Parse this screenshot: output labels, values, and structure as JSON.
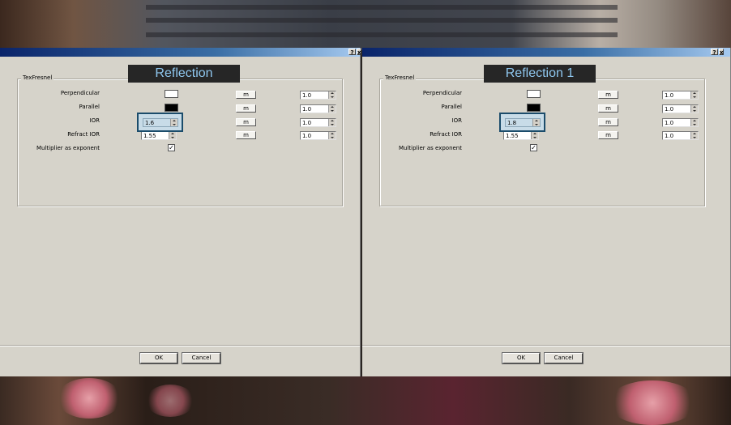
{
  "dialogs": [
    {
      "heading": "Reflection",
      "title_help_icon": "?",
      "title_close_icon": "x",
      "group_label": "TexFresnel",
      "rows": {
        "perpendicular": {
          "label": "Perpendicular",
          "swatch_color": "#ffffff",
          "map_label": "m",
          "value": "1.0"
        },
        "parallel": {
          "label": "Parallel",
          "swatch_color": "#000000",
          "map_label": "m",
          "value": "1.0"
        },
        "ior": {
          "label": "IOR",
          "input": "1.6",
          "map_label": "m",
          "value": "1.0"
        },
        "refract_ior": {
          "label": "Refract IOR",
          "input": "1.55",
          "map_label": "m",
          "value": "1.0"
        },
        "multiplier": {
          "label": "Multiplier as exponent",
          "checked": "✓"
        }
      },
      "ok_label": "OK",
      "cancel_label": "Cancel"
    },
    {
      "heading": "Reflection 1",
      "title_help_icon": "?",
      "title_close_icon": "x",
      "group_label": "TexFresnel",
      "rows": {
        "perpendicular": {
          "label": "Perpendicular",
          "swatch_color": "#ffffff",
          "map_label": "m",
          "value": "1.0"
        },
        "parallel": {
          "label": "Parallel",
          "swatch_color": "#000000",
          "map_label": "m",
          "value": "1.0"
        },
        "ior": {
          "label": "IOR",
          "input": "1.8",
          "map_label": "m",
          "value": "1.0"
        },
        "refract_ior": {
          "label": "Refract IOR",
          "input": "1.55",
          "map_label": "m",
          "value": "1.0"
        },
        "multiplier": {
          "label": "Multiplier as exponent",
          "checked": "✓"
        }
      },
      "ok_label": "OK",
      "cancel_label": "Cancel"
    }
  ],
  "colors": {
    "heading_bg": "#262626",
    "heading_text": "#8fc7ef",
    "ior_highlight": "#1b4c6b",
    "dialog_bg": "#d6d3ca"
  }
}
